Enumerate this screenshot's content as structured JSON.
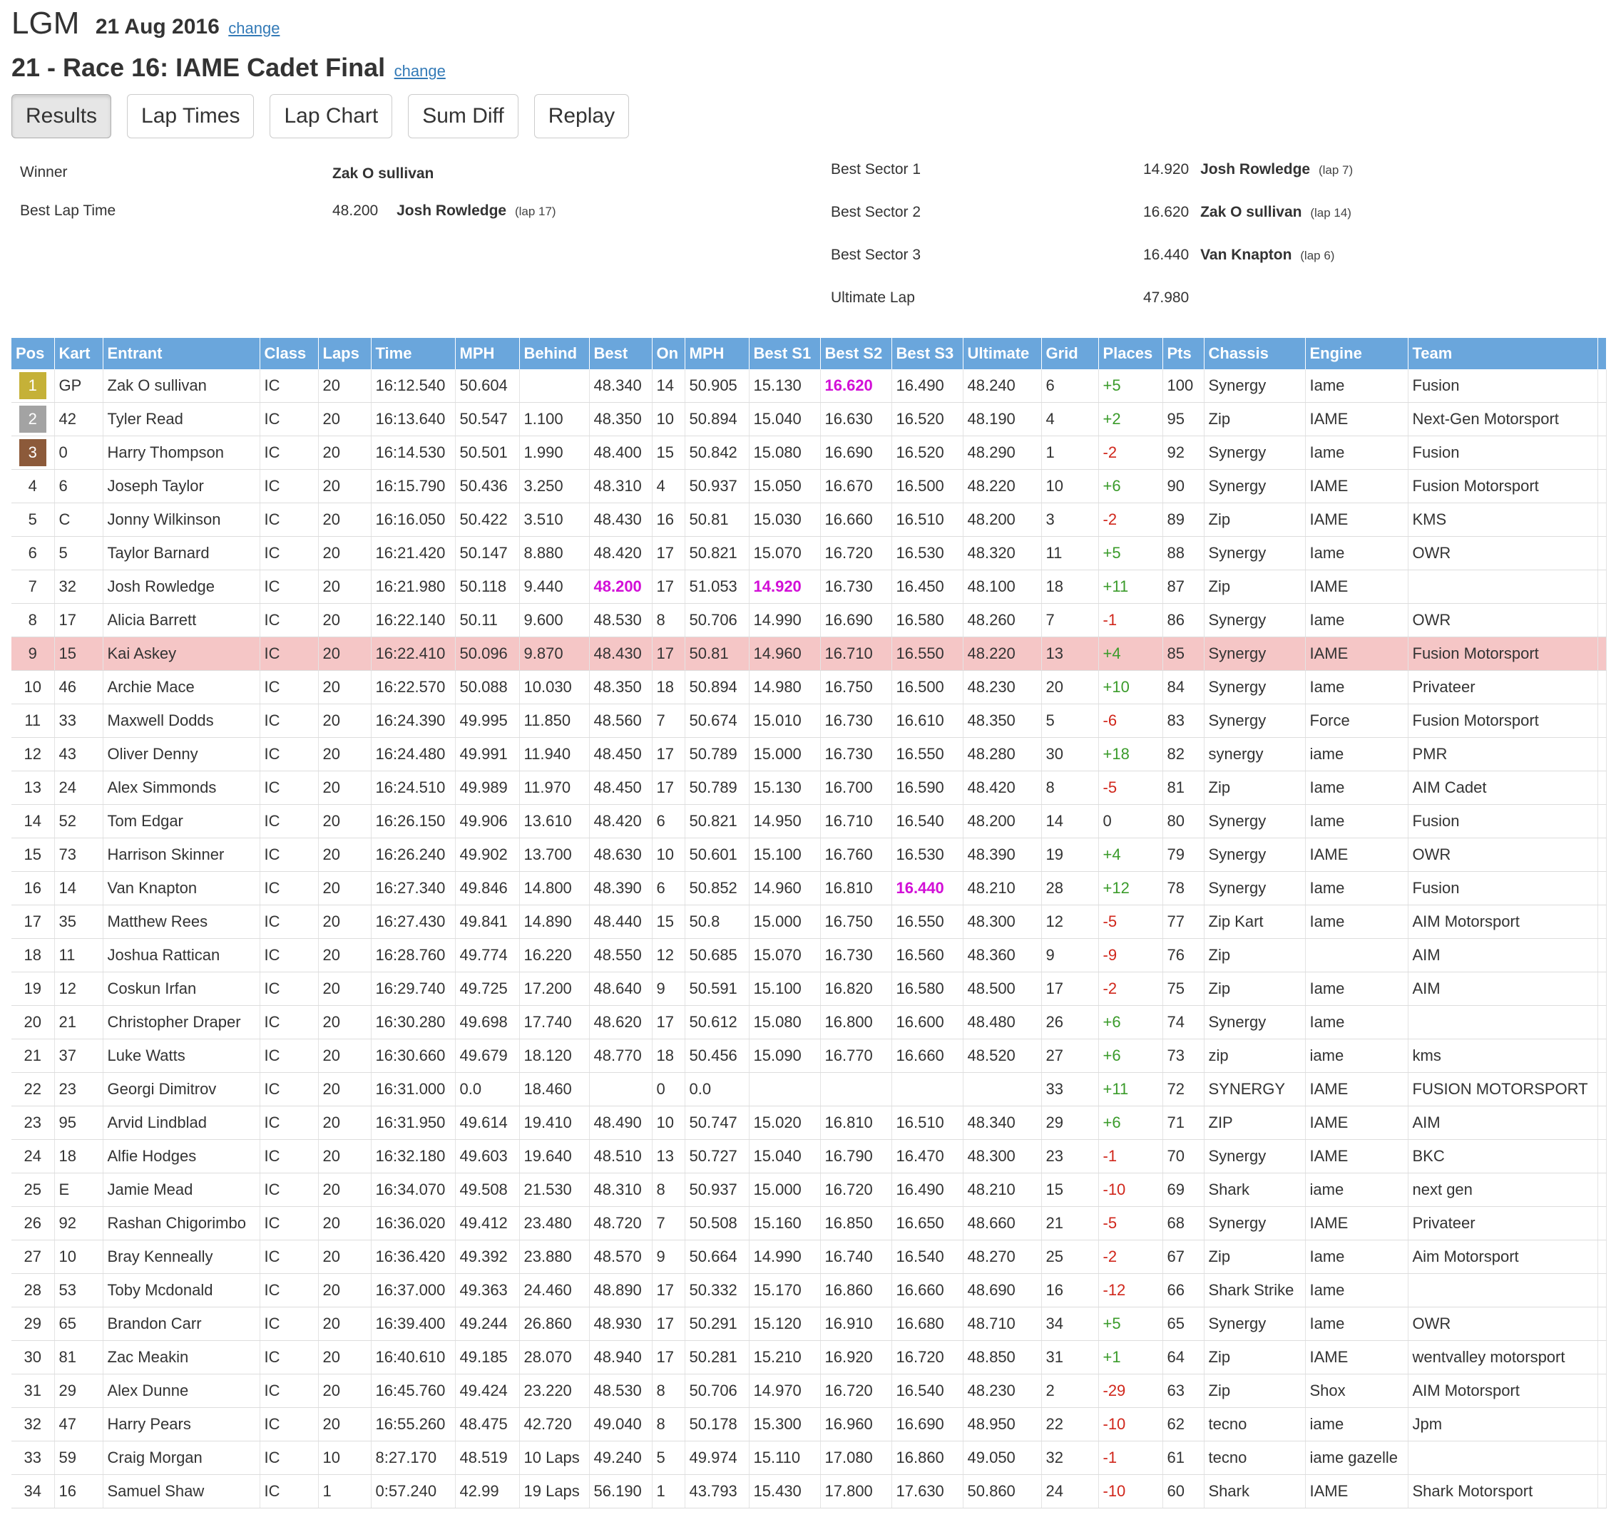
{
  "header": {
    "venue": "LGM",
    "date": "21 Aug 2016",
    "date_change": "change",
    "race_title": "21 - Race 16: IAME Cadet Final",
    "race_change": "change"
  },
  "tabs": [
    "Results",
    "Lap Times",
    "Lap Chart",
    "Sum Diff",
    "Replay"
  ],
  "active_tab": "Results",
  "summary": {
    "winner_label": "Winner",
    "winner_name": "Zak O sullivan",
    "best_lap_label": "Best Lap Time",
    "best_lap_time": "48.200",
    "best_lap_name": "Josh Rowledge",
    "best_lap_lap": "(lap 17)",
    "best_s1_label": "Best Sector 1",
    "best_s1_time": "14.920",
    "best_s1_name": "Josh Rowledge",
    "best_s1_lap": "(lap 7)",
    "best_s2_label": "Best Sector 2",
    "best_s2_time": "16.620",
    "best_s2_name": "Zak O sullivan",
    "best_s2_lap": "(lap 14)",
    "best_s3_label": "Best Sector 3",
    "best_s3_time": "16.440",
    "best_s3_name": "Van Knapton",
    "best_s3_lap": "(lap 6)",
    "ultimate_label": "Ultimate Lap",
    "ultimate_time": "47.980"
  },
  "columns": [
    "Pos",
    "Kart",
    "Entrant",
    "Class",
    "Laps",
    "Time",
    "MPH",
    "Behind",
    "Best",
    "On",
    "MPH",
    "Best S1",
    "Best S2",
    "Best S3",
    "Ultimate",
    "Grid",
    "Places",
    "Pts",
    "Chassis",
    "Engine",
    "Team"
  ],
  "colors": {
    "header_bg": "#6aa6dc",
    "gold": "#c5b138",
    "silver": "#a3a3a3",
    "bronze": "#8c5a3a",
    "highlight_row": "#f5c6c6",
    "best_purple": "#d20fd7",
    "gain_green": "#3a9b2a",
    "loss_red": "#d0261b",
    "link_blue": "#337ab7"
  },
  "highlight_row_index": 8,
  "rows": [
    [
      "1",
      "GP",
      "Zak O sullivan",
      "IC",
      "20",
      "16:12.540",
      "50.604",
      "",
      "48.340",
      "14",
      "50.905",
      "15.130",
      "16.620",
      "16.490",
      "48.240",
      "6",
      "+5",
      "100",
      "Synergy",
      "Iame",
      "Fusion"
    ],
    [
      "2",
      "42",
      "Tyler Read",
      "IC",
      "20",
      "16:13.640",
      "50.547",
      "1.100",
      "48.350",
      "10",
      "50.894",
      "15.040",
      "16.630",
      "16.520",
      "48.190",
      "4",
      "+2",
      "95",
      "Zip",
      "IAME",
      "Next-Gen Motorsport"
    ],
    [
      "3",
      "0",
      "Harry Thompson",
      "IC",
      "20",
      "16:14.530",
      "50.501",
      "1.990",
      "48.400",
      "15",
      "50.842",
      "15.080",
      "16.690",
      "16.520",
      "48.290",
      "1",
      "-2",
      "92",
      "Synergy",
      "Iame",
      "Fusion"
    ],
    [
      "4",
      "6",
      "Joseph Taylor",
      "IC",
      "20",
      "16:15.790",
      "50.436",
      "3.250",
      "48.310",
      "4",
      "50.937",
      "15.050",
      "16.670",
      "16.500",
      "48.220",
      "10",
      "+6",
      "90",
      "Synergy",
      "IAME",
      "Fusion Motorsport"
    ],
    [
      "5",
      "C",
      "Jonny Wilkinson",
      "IC",
      "20",
      "16:16.050",
      "50.422",
      "3.510",
      "48.430",
      "16",
      "50.81",
      "15.030",
      "16.660",
      "16.510",
      "48.200",
      "3",
      "-2",
      "89",
      "Zip",
      "IAME",
      "KMS"
    ],
    [
      "6",
      "5",
      "Taylor Barnard",
      "IC",
      "20",
      "16:21.420",
      "50.147",
      "8.880",
      "48.420",
      "17",
      "50.821",
      "15.070",
      "16.720",
      "16.530",
      "48.320",
      "11",
      "+5",
      "88",
      "Synergy",
      "Iame",
      "OWR"
    ],
    [
      "7",
      "32",
      "Josh Rowledge",
      "IC",
      "20",
      "16:21.980",
      "50.118",
      "9.440",
      "48.200",
      "17",
      "51.053",
      "14.920",
      "16.730",
      "16.450",
      "48.100",
      "18",
      "+11",
      "87",
      "Zip",
      "IAME",
      ""
    ],
    [
      "8",
      "17",
      "Alicia Barrett",
      "IC",
      "20",
      "16:22.140",
      "50.11",
      "9.600",
      "48.530",
      "8",
      "50.706",
      "14.990",
      "16.690",
      "16.580",
      "48.260",
      "7",
      "-1",
      "86",
      "Synergy",
      "Iame",
      "OWR"
    ],
    [
      "9",
      "15",
      "Kai Askey",
      "IC",
      "20",
      "16:22.410",
      "50.096",
      "9.870",
      "48.430",
      "17",
      "50.81",
      "14.960",
      "16.710",
      "16.550",
      "48.220",
      "13",
      "+4",
      "85",
      "Synergy",
      "IAME",
      "Fusion Motorsport"
    ],
    [
      "10",
      "46",
      "Archie Mace",
      "IC",
      "20",
      "16:22.570",
      "50.088",
      "10.030",
      "48.350",
      "18",
      "50.894",
      "14.980",
      "16.750",
      "16.500",
      "48.230",
      "20",
      "+10",
      "84",
      "Synergy",
      "Iame",
      "Privateer"
    ],
    [
      "11",
      "33",
      "Maxwell Dodds",
      "IC",
      "20",
      "16:24.390",
      "49.995",
      "11.850",
      "48.560",
      "7",
      "50.674",
      "15.010",
      "16.730",
      "16.610",
      "48.350",
      "5",
      "-6",
      "83",
      "Synergy",
      "Force",
      "Fusion Motorsport"
    ],
    [
      "12",
      "43",
      "Oliver Denny",
      "IC",
      "20",
      "16:24.480",
      "49.991",
      "11.940",
      "48.450",
      "17",
      "50.789",
      "15.000",
      "16.730",
      "16.550",
      "48.280",
      "30",
      "+18",
      "82",
      "synergy",
      "iame",
      "PMR"
    ],
    [
      "13",
      "24",
      "Alex Simmonds",
      "IC",
      "20",
      "16:24.510",
      "49.989",
      "11.970",
      "48.450",
      "17",
      "50.789",
      "15.130",
      "16.700",
      "16.590",
      "48.420",
      "8",
      "-5",
      "81",
      "Zip",
      "Iame",
      "AIM Cadet"
    ],
    [
      "14",
      "52",
      "Tom Edgar",
      "IC",
      "20",
      "16:26.150",
      "49.906",
      "13.610",
      "48.420",
      "6",
      "50.821",
      "14.950",
      "16.710",
      "16.540",
      "48.200",
      "14",
      "0",
      "80",
      "Synergy",
      "Iame",
      "Fusion"
    ],
    [
      "15",
      "73",
      "Harrison Skinner",
      "IC",
      "20",
      "16:26.240",
      "49.902",
      "13.700",
      "48.630",
      "10",
      "50.601",
      "15.100",
      "16.760",
      "16.530",
      "48.390",
      "19",
      "+4",
      "79",
      "Synergy",
      "IAME",
      "OWR"
    ],
    [
      "16",
      "14",
      "Van Knapton",
      "IC",
      "20",
      "16:27.340",
      "49.846",
      "14.800",
      "48.390",
      "6",
      "50.852",
      "14.960",
      "16.810",
      "16.440",
      "48.210",
      "28",
      "+12",
      "78",
      "Synergy",
      "Iame",
      "Fusion"
    ],
    [
      "17",
      "35",
      "Matthew Rees",
      "IC",
      "20",
      "16:27.430",
      "49.841",
      "14.890",
      "48.440",
      "15",
      "50.8",
      "15.000",
      "16.750",
      "16.550",
      "48.300",
      "12",
      "-5",
      "77",
      "Zip Kart",
      "Iame",
      "AIM Motorsport"
    ],
    [
      "18",
      "11",
      "Joshua Rattican",
      "IC",
      "20",
      "16:28.760",
      "49.774",
      "16.220",
      "48.550",
      "12",
      "50.685",
      "15.070",
      "16.730",
      "16.560",
      "48.360",
      "9",
      "-9",
      "76",
      "Zip",
      "",
      "AIM"
    ],
    [
      "19",
      "12",
      "Coskun Irfan",
      "IC",
      "20",
      "16:29.740",
      "49.725",
      "17.200",
      "48.640",
      "9",
      "50.591",
      "15.100",
      "16.820",
      "16.580",
      "48.500",
      "17",
      "-2",
      "75",
      "Zip",
      "Iame",
      "AIM"
    ],
    [
      "20",
      "21",
      "Christopher Draper",
      "IC",
      "20",
      "16:30.280",
      "49.698",
      "17.740",
      "48.620",
      "17",
      "50.612",
      "15.080",
      "16.800",
      "16.600",
      "48.480",
      "26",
      "+6",
      "74",
      "Synergy",
      "Iame",
      ""
    ],
    [
      "21",
      "37",
      "Luke Watts",
      "IC",
      "20",
      "16:30.660",
      "49.679",
      "18.120",
      "48.770",
      "18",
      "50.456",
      "15.090",
      "16.770",
      "16.660",
      "48.520",
      "27",
      "+6",
      "73",
      "zip",
      "iame",
      "kms"
    ],
    [
      "22",
      "23",
      "Georgi Dimitrov",
      "IC",
      "20",
      "16:31.000",
      "0.0",
      "18.460",
      "",
      "0",
      "0.0",
      "",
      "",
      "",
      "",
      "33",
      "+11",
      "72",
      "SYNERGY",
      "IAME",
      "FUSION MOTORSPORT"
    ],
    [
      "23",
      "95",
      "Arvid Lindblad",
      "IC",
      "20",
      "16:31.950",
      "49.614",
      "19.410",
      "48.490",
      "10",
      "50.747",
      "15.020",
      "16.810",
      "16.510",
      "48.340",
      "29",
      "+6",
      "71",
      "ZIP",
      "IAME",
      "AIM"
    ],
    [
      "24",
      "18",
      "Alfie Hodges",
      "IC",
      "20",
      "16:32.180",
      "49.603",
      "19.640",
      "48.510",
      "13",
      "50.727",
      "15.040",
      "16.790",
      "16.470",
      "48.300",
      "23",
      "-1",
      "70",
      "Synergy",
      "IAME",
      "BKC"
    ],
    [
      "25",
      "E",
      "Jamie Mead",
      "IC",
      "20",
      "16:34.070",
      "49.508",
      "21.530",
      "48.310",
      "8",
      "50.937",
      "15.000",
      "16.720",
      "16.490",
      "48.210",
      "15",
      "-10",
      "69",
      "Shark",
      "iame",
      "next gen"
    ],
    [
      "26",
      "92",
      "Rashan Chigorimbo",
      "IC",
      "20",
      "16:36.020",
      "49.412",
      "23.480",
      "48.720",
      "7",
      "50.508",
      "15.160",
      "16.850",
      "16.650",
      "48.660",
      "21",
      "-5",
      "68",
      "Synergy",
      "IAME",
      "Privateer"
    ],
    [
      "27",
      "10",
      "Bray Kenneally",
      "IC",
      "20",
      "16:36.420",
      "49.392",
      "23.880",
      "48.570",
      "9",
      "50.664",
      "14.990",
      "16.740",
      "16.540",
      "48.270",
      "25",
      "-2",
      "67",
      "Zip",
      "Iame",
      "Aim Motorsport"
    ],
    [
      "28",
      "53",
      "Toby Mcdonald",
      "IC",
      "20",
      "16:37.000",
      "49.363",
      "24.460",
      "48.890",
      "17",
      "50.332",
      "15.170",
      "16.860",
      "16.660",
      "48.690",
      "16",
      "-12",
      "66",
      "Shark Strike",
      "Iame",
      ""
    ],
    [
      "29",
      "65",
      "Brandon Carr",
      "IC",
      "20",
      "16:39.400",
      "49.244",
      "26.860",
      "48.930",
      "17",
      "50.291",
      "15.120",
      "16.910",
      "16.680",
      "48.710",
      "34",
      "+5",
      "65",
      "Synergy",
      "Iame",
      "OWR"
    ],
    [
      "30",
      "81",
      "Zac Meakin",
      "IC",
      "20",
      "16:40.610",
      "49.185",
      "28.070",
      "48.940",
      "17",
      "50.281",
      "15.210",
      "16.920",
      "16.720",
      "48.850",
      "31",
      "+1",
      "64",
      "Zip",
      "IAME",
      "wentvalley motorsport"
    ],
    [
      "31",
      "29",
      "Alex Dunne",
      "IC",
      "20",
      "16:45.760",
      "49.424",
      "23.220",
      "48.530",
      "8",
      "50.706",
      "14.970",
      "16.720",
      "16.540",
      "48.230",
      "2",
      "-29",
      "63",
      "Zip",
      "Shox",
      "AIM Motorsport"
    ],
    [
      "32",
      "47",
      "Harry Pears",
      "IC",
      "20",
      "16:55.260",
      "48.475",
      "42.720",
      "49.040",
      "8",
      "50.178",
      "15.300",
      "16.960",
      "16.690",
      "48.950",
      "22",
      "-10",
      "62",
      "tecno",
      "iame",
      "Jpm"
    ],
    [
      "33",
      "59",
      "Craig Morgan",
      "IC",
      "10",
      "8:27.170",
      "48.519",
      "10 Laps",
      "49.240",
      "5",
      "49.974",
      "15.110",
      "17.080",
      "16.860",
      "49.050",
      "32",
      "-1",
      "61",
      "tecno",
      "iame gazelle",
      ""
    ],
    [
      "34",
      "16",
      "Samuel Shaw",
      "IC",
      "1",
      "0:57.240",
      "42.99",
      "19 Laps",
      "56.190",
      "1",
      "43.793",
      "15.430",
      "17.800",
      "17.630",
      "50.860",
      "24",
      "-10",
      "60",
      "Shark",
      "IAME",
      "Shark Motorsport"
    ]
  ],
  "best_cells": [
    [
      0,
      12
    ],
    [
      6,
      8
    ],
    [
      6,
      11
    ],
    [
      15,
      13
    ]
  ]
}
